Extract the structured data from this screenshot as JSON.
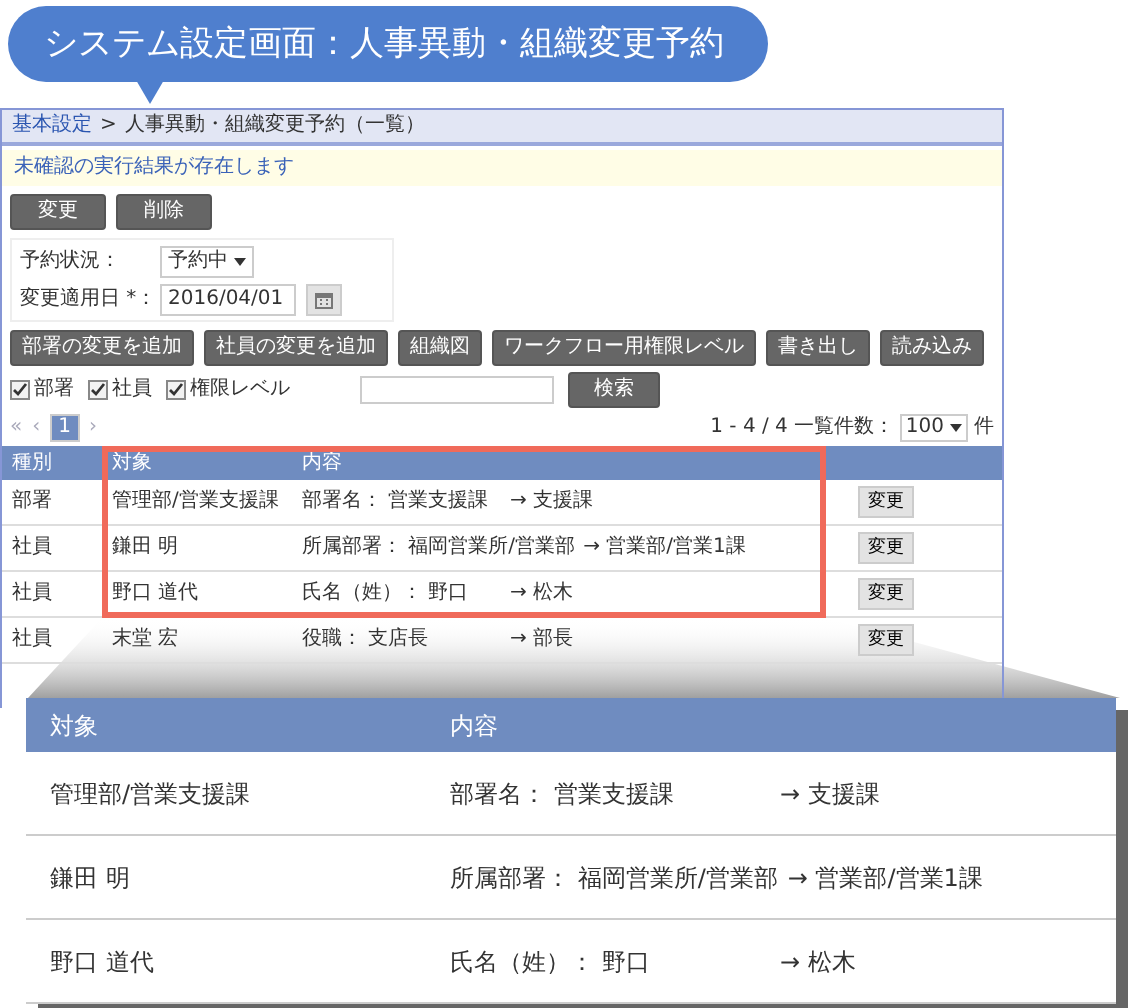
{
  "title_bubble": {
    "text": "システム設定画面：人事異動・組織変更予約"
  },
  "breadcrumb": {
    "link": "基本設定",
    "separator": ">",
    "current": "人事異動・組織変更予約（一覧）"
  },
  "notice": "未確認の実行結果が存在します",
  "top_buttons": [
    "変更",
    "削除"
  ],
  "form": [
    {
      "kind": "select",
      "label": "予約状況：",
      "value": "予約中"
    },
    {
      "kind": "date",
      "label": "変更適用日 *：",
      "value": "2016/04/01"
    }
  ],
  "action_buttons": [
    "部署の変更を追加",
    "社員の変更を追加",
    "組織図",
    "ワークフロー用権限レベル",
    "書き出し",
    "読み込み"
  ],
  "filters": [
    {
      "label": "部署",
      "checked": true
    },
    {
      "label": "社員",
      "checked": true
    },
    {
      "label": "権限レベル",
      "checked": true
    }
  ],
  "search_button": "検索",
  "pager": {
    "first": "«",
    "prev": "‹",
    "pages": [
      {
        "label": "1",
        "selected": true
      }
    ],
    "next": "›"
  },
  "page_info": {
    "range": "1 - 4 / 4",
    "per_page_label": "一覧件数：",
    "per_page": "100",
    "unit": "件"
  },
  "table": {
    "columns": [
      "種別",
      "対象",
      "内容"
    ],
    "rows": [
      {
        "type": "部署",
        "target": "管理部/営業支援課",
        "from": "部署名： 営業支援課",
        "to": "→ 支援課",
        "button": "変更"
      },
      {
        "type": "社員",
        "target": "鎌田 明",
        "from": "所属部署： 福岡営業所/営業部",
        "to": "→ 営業部/営業1課",
        "button": "変更"
      },
      {
        "type": "社員",
        "target": "野口 道代",
        "from": "氏名（姓）： 野口",
        "to": "→ 松木",
        "button": "変更"
      },
      {
        "type": "社員",
        "target": "末堂 宏",
        "from": "役職： 支店長",
        "to": "→ 部長",
        "button": "変更"
      }
    ]
  },
  "magnified": {
    "columns": [
      "対象",
      "内容"
    ],
    "rows": [
      {
        "target": "管理部/営業支援課",
        "from": "部署名： 営業支援課",
        "to": "→ 支援課"
      },
      {
        "target": "鎌田 明",
        "from": "所属部署： 福岡営業所/営業部",
        "to": "→ 営業部/営業1課"
      },
      {
        "target": "野口 道代",
        "from": "氏名（姓）： 野口",
        "to": "→ 松木"
      }
    ]
  }
}
